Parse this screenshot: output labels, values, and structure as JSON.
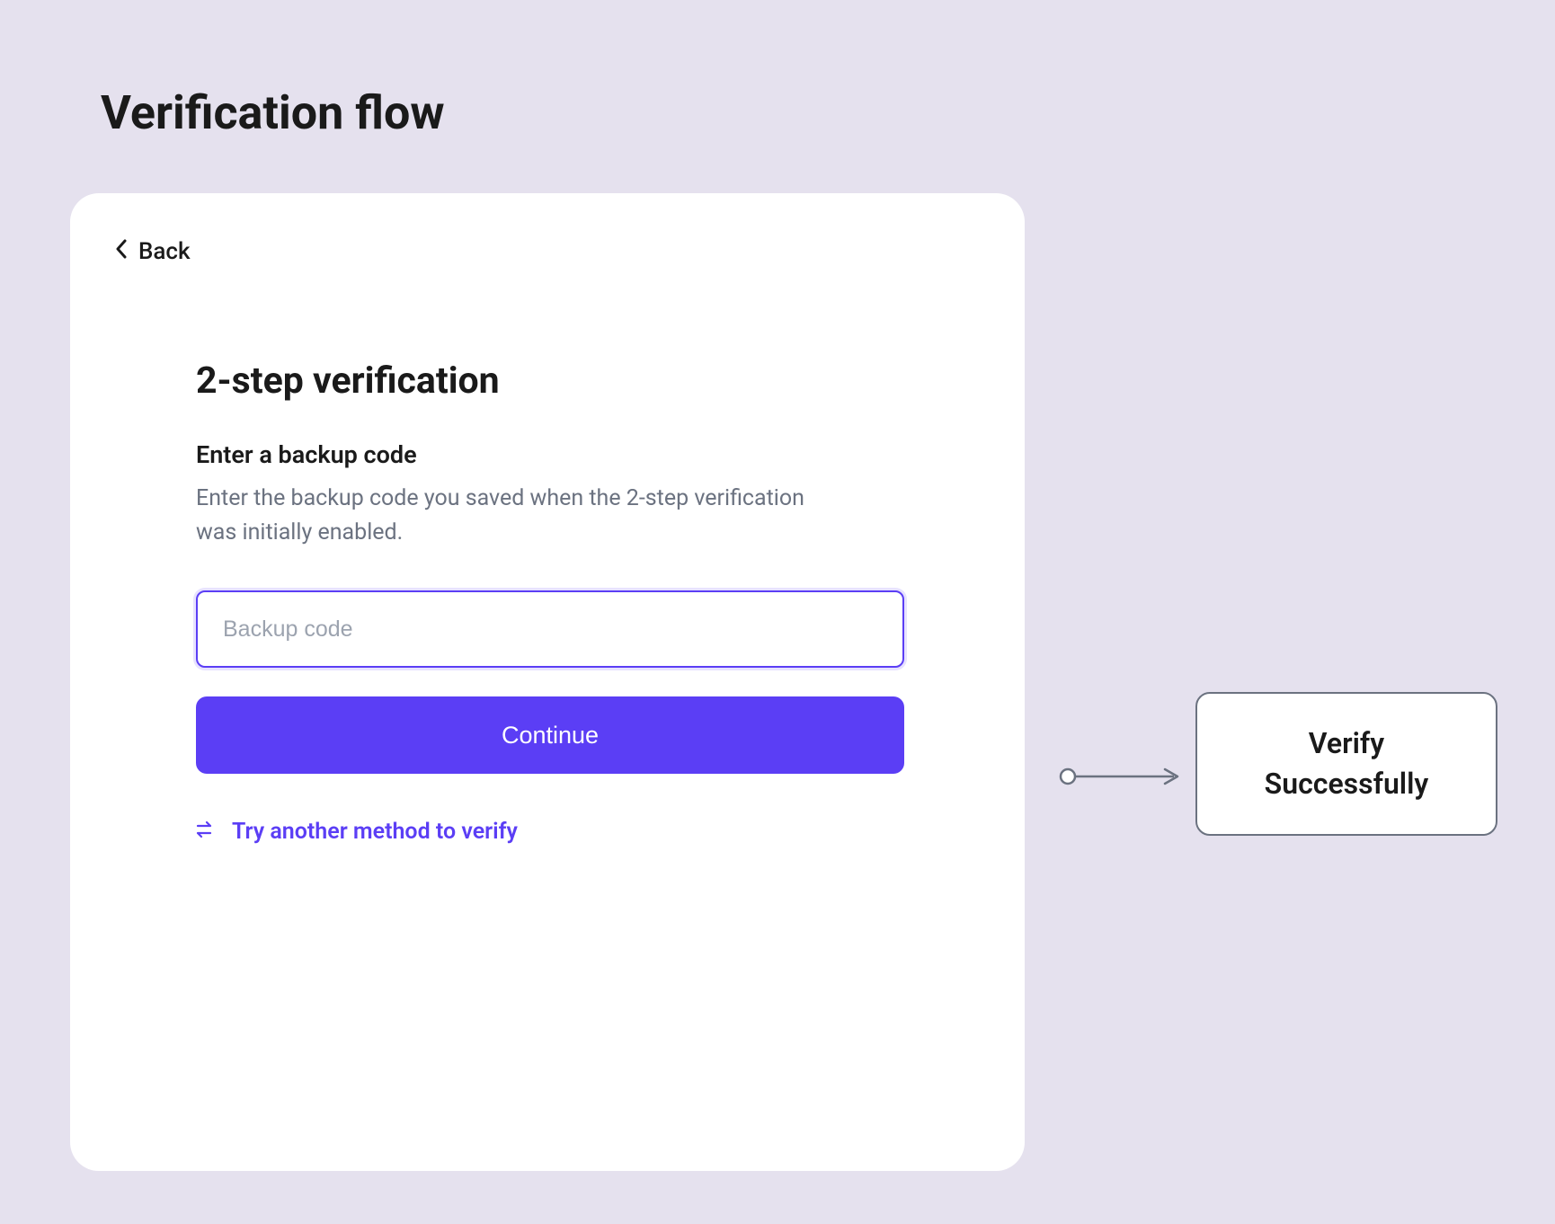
{
  "page": {
    "title": "Verification flow"
  },
  "card": {
    "back_label": "Back",
    "heading": "2-step verification",
    "subheading": "Enter a backup code",
    "description": "Enter the backup code you saved when the 2-step verification was initially enabled.",
    "input_placeholder": "Backup code",
    "input_value": "",
    "continue_label": "Continue",
    "alt_method_label": "Try another method to verify"
  },
  "result_node": {
    "line1": "Verify",
    "line2": "Successfully"
  }
}
